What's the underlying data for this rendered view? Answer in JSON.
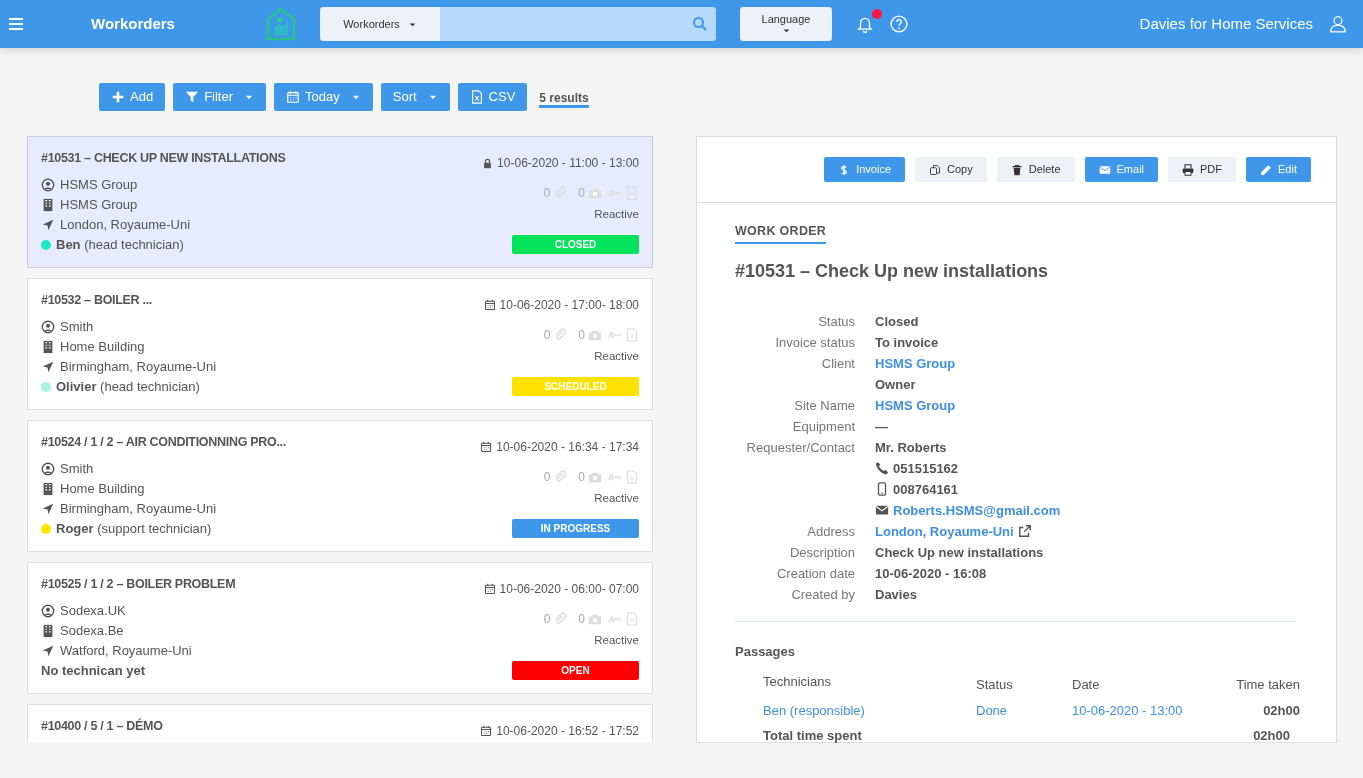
{
  "navbar": {
    "title": "Workorders",
    "search": {
      "scope": "Workorders"
    },
    "language": "Language",
    "notifications": {
      "unread": true
    },
    "user": "Davies for Home Services"
  },
  "toolbar": {
    "buttons": [
      {
        "label": "Add",
        "kind": "plus",
        "dropdown": false
      },
      {
        "label": "Filter",
        "kind": "filter",
        "dropdown": true
      },
      {
        "label": "Today",
        "kind": "calendar",
        "dropdown": true
      },
      {
        "label": "Sort",
        "kind": "none",
        "dropdown": true
      },
      {
        "label": "CSV",
        "kind": "csv",
        "dropdown": false
      }
    ],
    "results": "5 results"
  },
  "workorders": [
    {
      "title": "#10531 – CHECK UP NEW INSTALLATIONS",
      "locked": true,
      "date": "10-06-2020 - 11:00 - 13:00",
      "client": "HSMS Group",
      "site": "HSMS Group",
      "location": "London, Royaume-Uni",
      "technician": {
        "name": "Ben",
        "role": "(head technician)",
        "color": "#1de9c6"
      },
      "attachments": "0",
      "photos": "0",
      "type": "Reactive",
      "status": {
        "label": "CLOSED",
        "color": "#00e35b"
      },
      "selected": true
    },
    {
      "title": "#10532 – BOILER ...",
      "locked": false,
      "date": "10-06-2020 - 17:00- 18:00",
      "client": "Smith",
      "site": "Home Building",
      "location": "Birmingham, Royaume-Uni",
      "technician": {
        "name": "Olivier",
        "role": "(head technician)",
        "color": "#a6f5dc"
      },
      "attachments": "0",
      "photos": "0",
      "type": "Reactive",
      "status": {
        "label": "SCHEDULED",
        "color": "#ffe100"
      },
      "selected": false
    },
    {
      "title": "#10524 / 1 / 2 – AIR CONDITIONNING PRO...",
      "locked": false,
      "date": "10-06-2020 - 16:34 - 17:34",
      "client": "Smith",
      "site": "Home Building",
      "location": "Birmingham, Royaume-Uni",
      "technician": {
        "name": "Roger",
        "role": "(support technician)",
        "color": "#ffe600"
      },
      "attachments": "0",
      "photos": "0",
      "type": "Reactive",
      "status": {
        "label": "IN PROGRESS",
        "color": "#3f97ea"
      },
      "selected": false
    },
    {
      "title": "#10525 / 1 / 2 – BOILER PROBLEM",
      "locked": false,
      "date": "10-06-2020 - 06:00- 07:00",
      "client": "Sodexa.UK",
      "site": "Sodexa.Be",
      "location": "Watford, Royaume-Uni",
      "no_technician": "No technican yet",
      "attachments": "0",
      "photos": "0",
      "type": "Reactive",
      "status": {
        "label": "OPEN",
        "color": "#ff0000"
      },
      "selected": false
    },
    {
      "title": "#10400 / 5 / 1 – DÉMO",
      "locked": false,
      "date": "10-06-2020 - 16:52 - 17:52",
      "selected": false
    }
  ],
  "detail": {
    "actions": [
      {
        "label": "Invoice",
        "kind": "dollar",
        "primary": true
      },
      {
        "label": "Copy",
        "kind": "copy",
        "primary": false
      },
      {
        "label": "Delete",
        "kind": "trash",
        "primary": false
      },
      {
        "label": "Email",
        "kind": "envelope",
        "primary": true
      },
      {
        "label": "PDF",
        "kind": "print",
        "primary": false
      },
      {
        "label": "Edit",
        "kind": "pencil",
        "primary": true
      }
    ],
    "section": "WORK ORDER",
    "title": "#10531 – Check Up new installations",
    "fields": [
      {
        "label": "Status",
        "value": "Closed",
        "kind": "text"
      },
      {
        "label": "Invoice status",
        "value": "To invoice",
        "kind": "text"
      },
      {
        "label": "Client",
        "value": "HSMS Group",
        "kind": "link"
      },
      {
        "value": "Owner",
        "kind": "text"
      },
      {
        "label": "Site Name",
        "value": "HSMS Group",
        "kind": "link"
      },
      {
        "label": "Equipment",
        "value": "—",
        "kind": "text"
      },
      {
        "label": "Requester/Contact",
        "value": "Mr. Roberts",
        "kind": "text"
      },
      {
        "value": "051515162",
        "kind": "phone"
      },
      {
        "value": "008764161",
        "kind": "mobile"
      },
      {
        "value": "Roberts.HSMS@gmail.com",
        "kind": "email"
      },
      {
        "label": "Address",
        "value": "London, Royaume-Uni",
        "kind": "address"
      },
      {
        "label": "Description",
        "value": "Check Up new installations",
        "kind": "text"
      },
      {
        "label": "Creation date",
        "value": "10-06-2020 - 16:08",
        "kind": "text"
      },
      {
        "label": "Created by",
        "value": "Davies",
        "kind": "text"
      }
    ],
    "passages": {
      "heading": "Passages",
      "columns": [
        "Technicians",
        "Status",
        "Date",
        "Time taken"
      ],
      "rows": [
        {
          "technician": "Ben (responsible)",
          "status": "Done",
          "date": "10-06-2020 - 13:00",
          "time": "02h00"
        }
      ],
      "total_label": "Total time spent",
      "total": "02h00"
    }
  }
}
